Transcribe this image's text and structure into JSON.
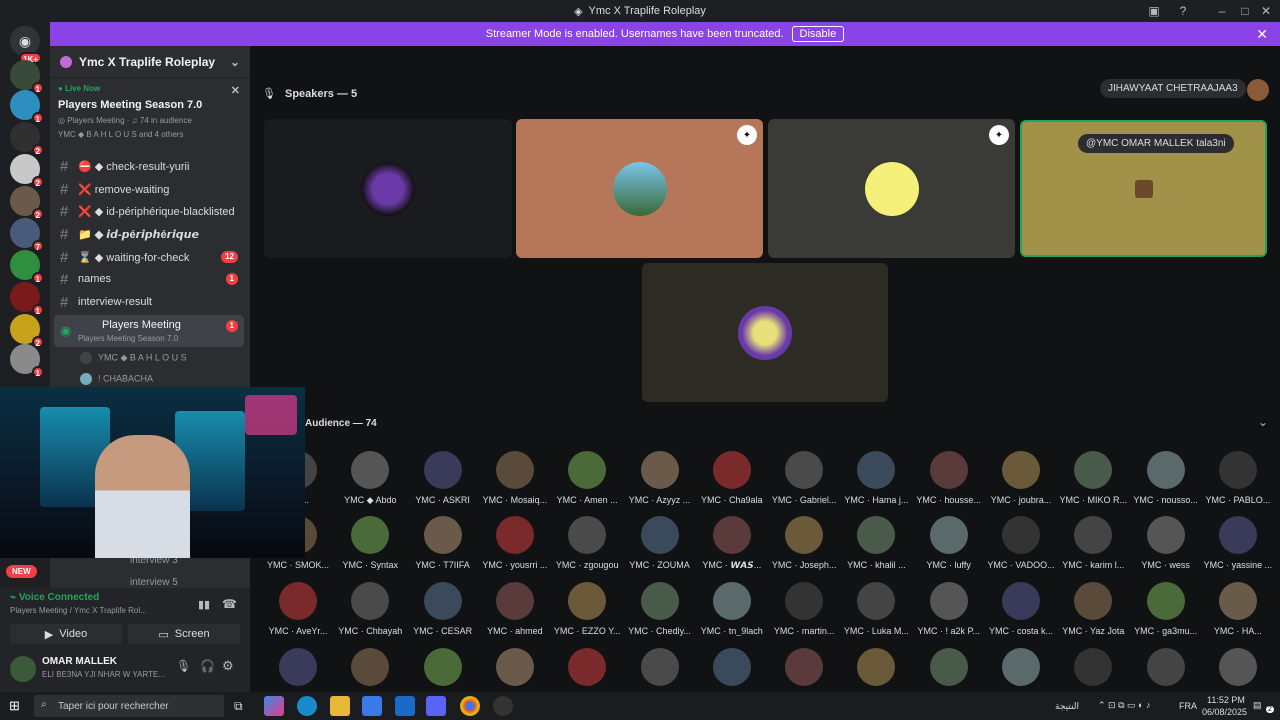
{
  "window": {
    "title": "Ymc X Traplife Roleplay"
  },
  "banner": {
    "text": "Streamer Mode is enabled. Usernames have been truncated.",
    "button": "Disable"
  },
  "guild_badges": [
    "1K+",
    "1",
    "1",
    "2",
    "2",
    "2",
    "7",
    "1",
    "1",
    "2",
    "1"
  ],
  "server": {
    "name": "Ymc X Traplife Roleplay"
  },
  "live": {
    "tag": "Live Now",
    "title": "Players Meeting Season 7.0",
    "subtitle": "Players Meeting",
    "audience": "74 in audience",
    "people": "YMC ◆ B A H L O U S and 4 others"
  },
  "channels": [
    {
      "name": "⛔ ◆ check-result-yurii",
      "count": ""
    },
    {
      "name": "❌ remove-waiting",
      "count": ""
    },
    {
      "name": "❌ ◆ id-périphérique-blacklisted",
      "count": ""
    },
    {
      "name": "📁 ◆ 𝙞𝙙-𝙥é𝙧𝙞𝙥𝙝é𝙧𝙞𝙦𝙪𝙚",
      "count": ""
    },
    {
      "name": "⌛ ◆ waiting-for-check",
      "count": "12"
    },
    {
      "name": "names",
      "count": "1"
    },
    {
      "name": "interview-result",
      "count": ""
    }
  ],
  "active_stage": {
    "name": "Players Meeting",
    "sub": "Players Meeting Season 7.0",
    "count": "1"
  },
  "stage_members": [
    "YMC ◆ B A H L O U S",
    "! CHABACHA"
  ],
  "lower_channels": [
    "interview 3",
    "interview 5"
  ],
  "new_badge": "NEW",
  "voice": {
    "status": "Voice Connected",
    "channel": "Players Meeting / Ymc X Traplife Rol...",
    "video": "Video",
    "screen": "Screen"
  },
  "user": {
    "name": "OMAR MALLEK",
    "status": "ELI BE3NA YJI NHAR W YARTE..."
  },
  "stage": {
    "speakers_header": "Speakers — 5",
    "audience_header": "Audience — 74",
    "top_name": "JIHAWYAAT CHETRAAJAA3",
    "pill_name": "@YMC   OMAR MALLEK",
    "pill_suffix": "tala3ni"
  },
  "speakers": [
    "BAHLOUS",
    "speaker-2",
    "speaker-3",
    "speaker-4",
    "speaker-5"
  ],
  "audience": [
    [
      "...nj...",
      "YMC ◆ Abdo",
      "YMC · ASKRI",
      "YMC · Mosaiq...",
      "YMC · Amen ...",
      "YMC · Azyyz ...",
      "YMC · Cha9ala",
      "YMC · Gabriel...",
      "YMC · Hama j...",
      "YMC · housse...",
      "YMC · joubra...",
      "YMC · MIKO R...",
      "YMC · nousso...",
      "YMC · PABLO..."
    ],
    [
      "YMC · SMOK...",
      "YMC · Syntax",
      "YMC · T7IIFA",
      "YMC · yousrri ...",
      "YMC · zgougou",
      "YMC · ZOUMA",
      "YMC · 𝙒𝘼𝙎...",
      "YMC · Joseph...",
      "YMC · khalil ...",
      "YMC · luffy",
      "YMC · VADOO...",
      "YMC · karim l...",
      "YMC · wess",
      "YMC · yassine ..."
    ],
    [
      "YMC · AveYr...",
      "YMC · Chbayah",
      "YMC · CESAR",
      "YMC · ahmed",
      "YMC · EZZO Y...",
      "YMC · Chedly...",
      "YMC · tn_9lach",
      "YMC · martin...",
      "YMC · Luka M...",
      "YMC · ! a2k P...",
      "YMC · costa k...",
      "YMC · Yaz Jota",
      "YMC · ga3mu...",
      "YMC · HA..."
    ]
  ],
  "taskbar": {
    "search": "Taper ici pour rechercher",
    "weather": "النتيجة",
    "lang": "FRA",
    "time": "11:52 PM",
    "date": "06/08/2025",
    "notif": "2"
  },
  "colors": {
    "accent": "#5865f2",
    "banner": "#8a43e6",
    "unread": "#f23f43",
    "online": "#23a55a"
  }
}
